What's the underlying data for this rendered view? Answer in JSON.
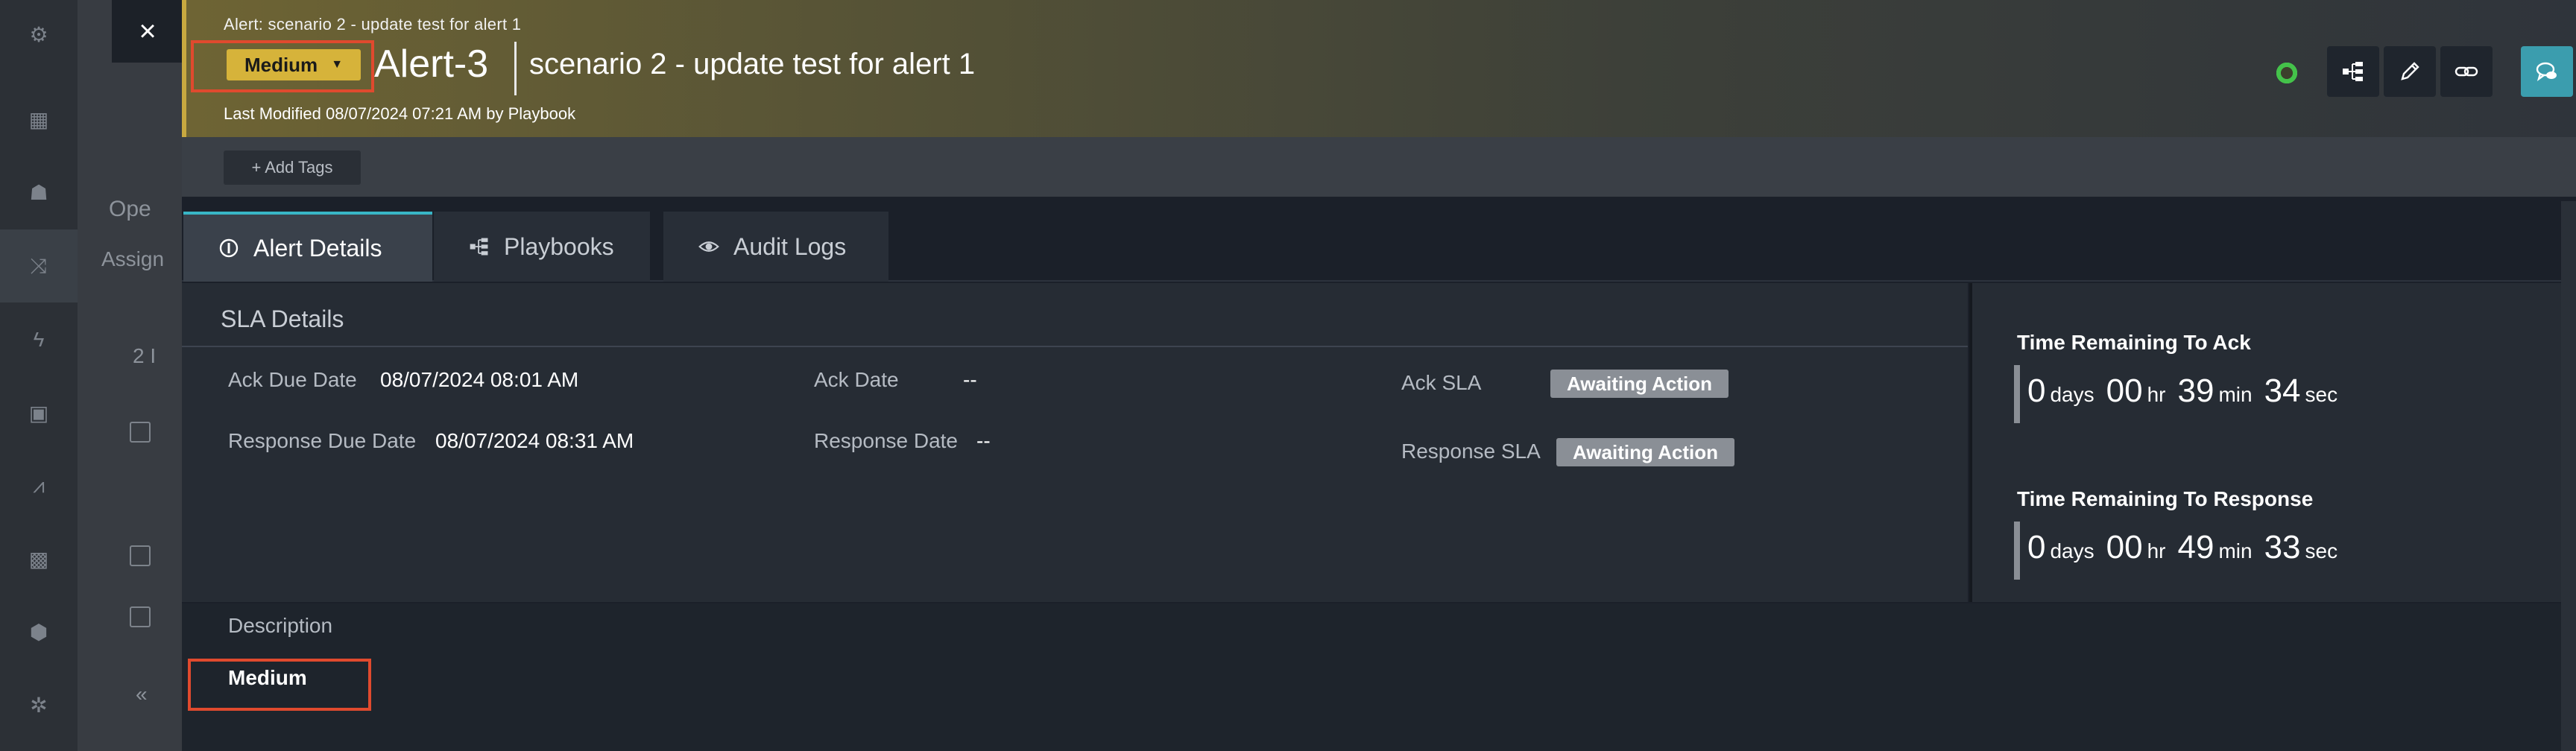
{
  "background_app": {
    "section_heading": "Ope",
    "subheading": "Assign",
    "count_fragment": "2 I",
    "pager": "«"
  },
  "close_label": "×",
  "header": {
    "breadcrumb": "Alert: scenario 2 - update test for alert 1",
    "severity": "Medium",
    "alert_id": "Alert-3",
    "alert_name": "scenario 2 - update test for alert 1",
    "last_modified": "Last Modified 08/07/2024 07:21 AM by Playbook",
    "colors": {
      "severity_bg": "#d6b33a",
      "highlight": "#e04a2e",
      "accent_teal": "#3b9dae"
    },
    "actions": [
      {
        "icon": "playbook-tree-icon"
      },
      {
        "icon": "pencil-icon"
      },
      {
        "icon": "link-icon"
      },
      {
        "icon": "collaboration-chat-icon"
      }
    ]
  },
  "tags": {
    "add_label": "+ Add Tags"
  },
  "tabs": [
    {
      "label": "Alert Details",
      "icon": "alert-details-icon",
      "active": true
    },
    {
      "label": "Playbooks",
      "icon": "playbook-tree-icon",
      "active": false
    },
    {
      "label": "Audit Logs",
      "icon": "eye-icon",
      "active": false
    }
  ],
  "sla": {
    "title": "SLA Details",
    "ack_due_label": "Ack Due Date",
    "ack_due_value": "08/07/2024 08:01 AM",
    "response_due_label": "Response Due Date",
    "response_due_value": "08/07/2024 08:31 AM",
    "ack_date_label": "Ack Date",
    "ack_date_value": "--",
    "response_date_label": "Response Date",
    "response_date_value": "--",
    "ack_sla_label": "Ack SLA",
    "ack_sla_status": "Awaiting Action",
    "response_sla_label": "Response SLA",
    "response_sla_status": "Awaiting Action"
  },
  "timers": {
    "ack": {
      "title": "Time Remaining To Ack",
      "days": "0",
      "days_unit": "days",
      "hours": "00",
      "hours_unit": "hr",
      "minutes": "39",
      "minutes_unit": "min",
      "seconds": "34",
      "seconds_unit": "sec"
    },
    "response": {
      "title": "Time Remaining To Response",
      "days": "0",
      "days_unit": "days",
      "hours": "00",
      "hours_unit": "hr",
      "minutes": "49",
      "minutes_unit": "min",
      "seconds": "33",
      "seconds_unit": "sec"
    }
  },
  "description": {
    "label": "Description",
    "value": "Medium"
  }
}
